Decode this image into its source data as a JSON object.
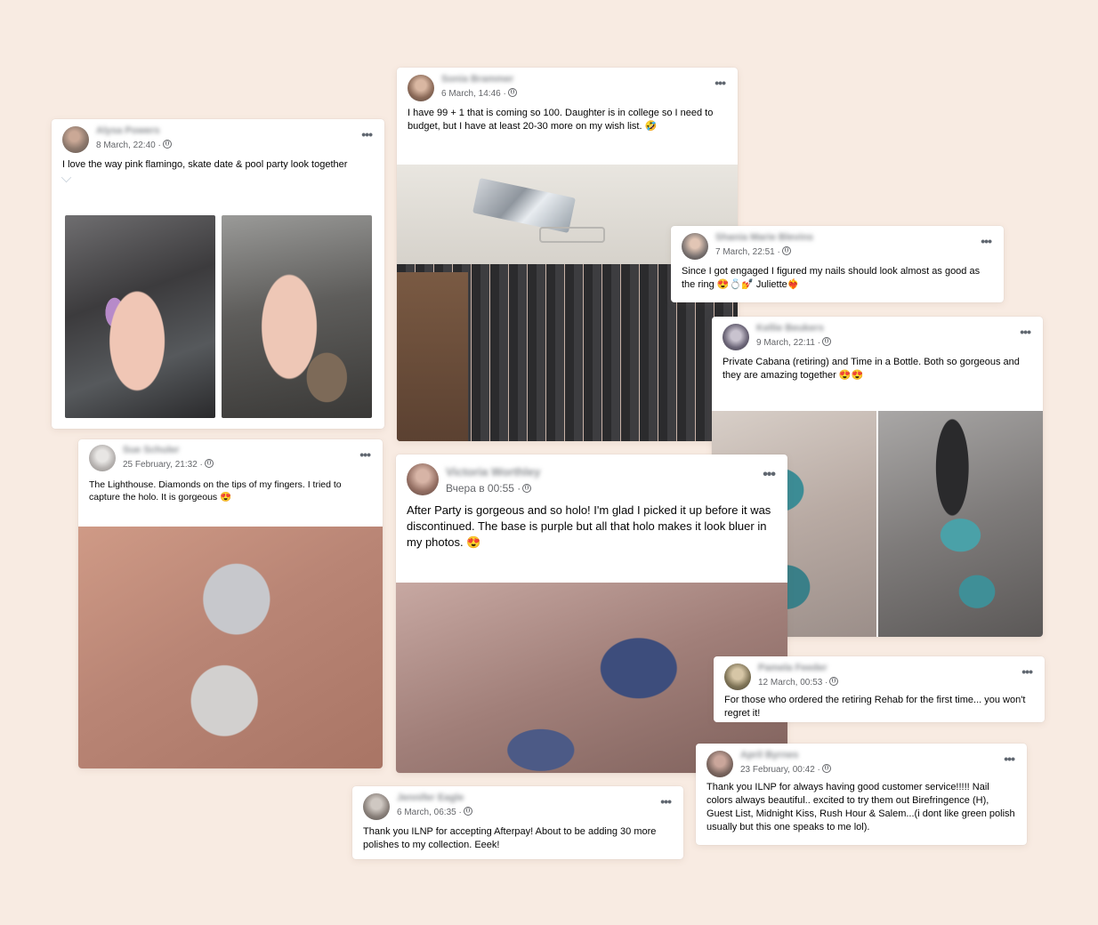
{
  "posts": [
    {
      "author": "Alysa Powers",
      "time": "8 March, 22:40 ·",
      "text": "I love the way pink flamingo, skate date & pool party look together",
      "photos": [
        "hand-photo-1",
        "hand-photo-2"
      ]
    },
    {
      "author": "Sonia Brammer",
      "time": "6 March, 14:46 ·",
      "text": "I have 99 + 1 that is coming so 100.  Daughter is in college so I need to budget,  but I have at least 20-30 more on my wish list.  🤣",
      "photos": [
        "polish-cabinet-photo"
      ]
    },
    {
      "author": "Shania Marie Blevins",
      "time": "7 March, 22:51 ·",
      "text": "Since I got engaged I figured my nails should look almost as good as the ring 😍💍💅 Juliette❤️‍🔥",
      "photos": []
    },
    {
      "author": "Kellie Beukers",
      "time": "9 March, 22:11 ·",
      "text": "Private Cabana (retiring) and Time in a Bottle. Both so gorgeous and they are amazing together 😍😍",
      "photos": [
        "teal-glitter-photo-1",
        "teal-glitter-photo-2"
      ]
    },
    {
      "author": "Sue Schuler",
      "time": "25 February, 21:32 ·",
      "text": "The Lighthouse. Diamonds on the tips of my fingers. I tried to capture the holo. It is gorgeous 😍",
      "photos": [
        "silver-holo-photo"
      ]
    },
    {
      "author": "Victoria Worthley",
      "time": "Вчера в 00:55 ·",
      "text": "After Party is gorgeous and so holo! I'm glad I picked it up before it was discontinued. The base is purple but all that holo makes it look bluer in my photos. 😍",
      "photos": [
        "blue-holo-photo"
      ]
    },
    {
      "author": "Pamela Feeder",
      "time": "12 March, 00:53 ·",
      "text": "For those who ordered the retiring Rehab for the first time... you won't regret it!",
      "photos": []
    },
    {
      "author": "April Byrnes",
      "time": "23 February, 00:42 ·",
      "text": "Thank you ILNP for always having good customer service!!!!! Nail colors always beautiful.. excited to try them out Birefringence (H), Guest List, Midnight Kiss, Rush Hour & Salem...(i dont like green polish usually but this one speaks to me lol).",
      "photos": []
    },
    {
      "author": "Jennifer Eagle",
      "time": "6 March, 06:35 ·",
      "text": "Thank you ILNP for accepting Afterpay! About to be adding 30 more polishes to my collection. Eeek!",
      "photos": []
    }
  ],
  "more_label": "•••",
  "colors": {
    "background": "#f8ebe2",
    "card": "#ffffff",
    "meta": "#65676b"
  }
}
